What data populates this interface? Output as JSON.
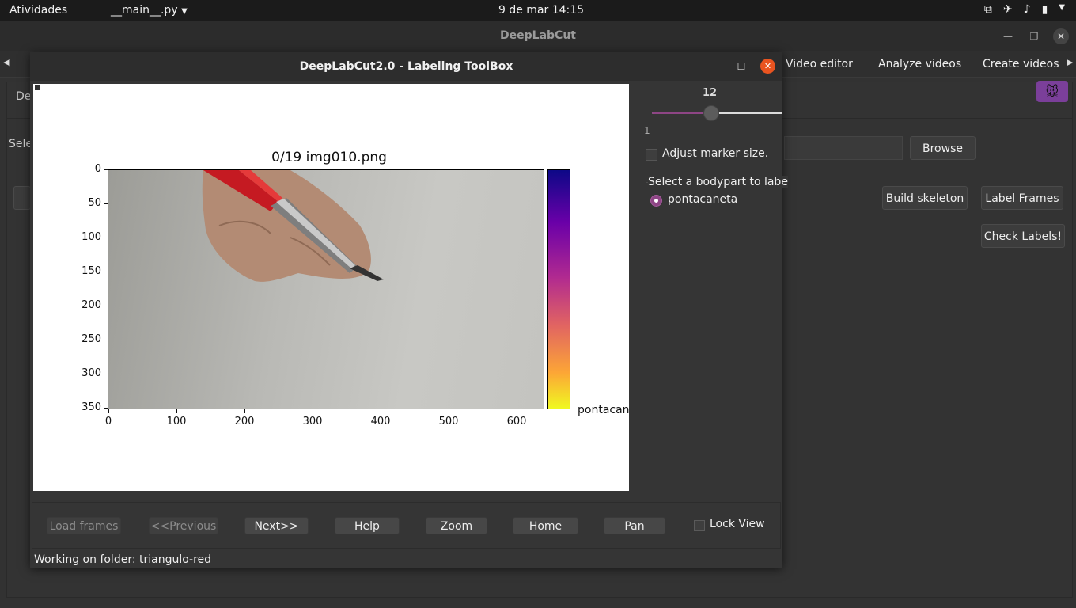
{
  "system_bar": {
    "activities": "Atividades",
    "app_menu": "__main__.py",
    "clock": "9 de mar  14:15",
    "tray_icons": [
      "network-icon",
      "airplane-icon",
      "volume-icon",
      "battery-icon",
      "power-menu-icon"
    ]
  },
  "main_window": {
    "title": "DeepLabCut",
    "tabs": [
      "Video editor",
      "Analyze videos",
      "Create videos"
    ],
    "partial_tab": "De",
    "partial_select_label": "Sele",
    "buttons": {
      "browse": "Browse",
      "build_skeleton": "Build skeleton",
      "label_frames": "Label Frames",
      "check_labels": "Check Labels!"
    }
  },
  "labeling_toolbox": {
    "title": "DeepLabCut2.0 - Labeling ToolBox",
    "plot": {
      "title": "0/19 img010.png",
      "y_ticks": [
        "0",
        "50",
        "100",
        "150",
        "200",
        "250",
        "300",
        "350"
      ],
      "x_ticks": [
        "0",
        "100",
        "200",
        "300",
        "400",
        "500",
        "600"
      ],
      "colorbar_label": "pontacan"
    },
    "marker_slider": {
      "value": "12",
      "min": "1",
      "fraction": 0.45
    },
    "adjust_marker_label": "Adjust marker size.",
    "bodypart_group_title": "Select a bodypart to labe",
    "bodypart_option": "pontacaneta",
    "buttons": {
      "load_frames": "Load frames",
      "previous": "<<Previous",
      "next": "Next>>",
      "help": "Help",
      "zoom": "Zoom",
      "home": "Home",
      "pan": "Pan"
    },
    "lock_view_label": "Lock View",
    "status": "Working on folder: triangulo-red"
  },
  "colors": {
    "accent": "#8e4585",
    "close_button": "#e95420",
    "logo_bg": "#7b3f9a"
  }
}
